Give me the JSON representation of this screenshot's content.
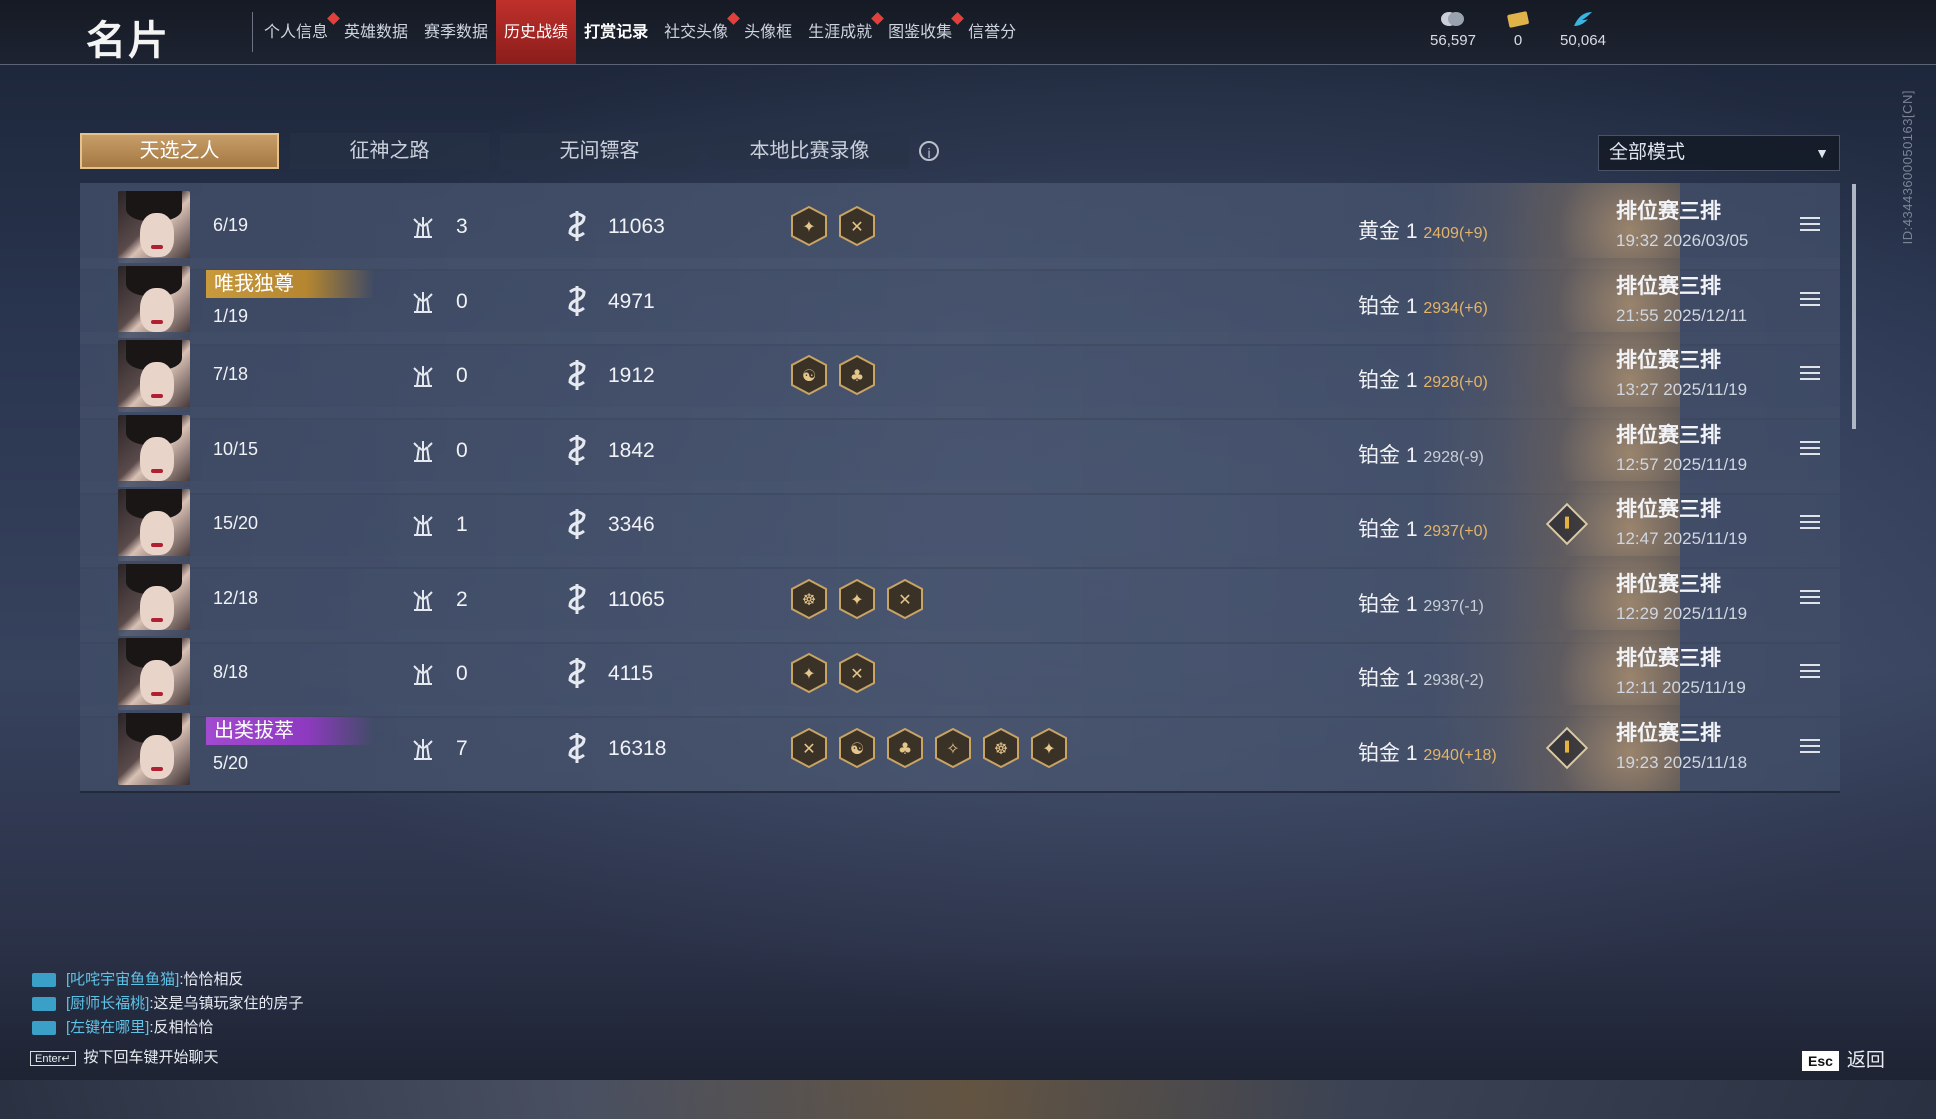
{
  "header": {
    "title": "名片",
    "tabs": [
      {
        "label": "个人信息",
        "dot": true
      },
      {
        "label": "英雄数据",
        "dot": false
      },
      {
        "label": "赛季数据",
        "dot": false
      },
      {
        "label": "历史战绩",
        "dot": false,
        "active": true
      },
      {
        "label": "打赏记录",
        "dot": false,
        "bold": true
      },
      {
        "label": "社交头像",
        "dot": true
      },
      {
        "label": "头像框",
        "dot": false
      },
      {
        "label": "生涯成就",
        "dot": true
      },
      {
        "label": "图鉴收集",
        "dot": true
      },
      {
        "label": "信誉分",
        "dot": false
      }
    ],
    "currencies": [
      {
        "icon": "coin-icon",
        "value": "56,597"
      },
      {
        "icon": "ticket-icon",
        "value": "0"
      },
      {
        "icon": "feather-icon",
        "value": "50,064"
      }
    ]
  },
  "sub_tabs": [
    "天选之人",
    "征神之路",
    "无间镖客",
    "本地比赛录像"
  ],
  "mode_select": {
    "value": "全部模式"
  },
  "side_id": "ID:43443600050163[CN]",
  "matches": [
    {
      "kda": "6/19",
      "badge": "",
      "mvp": "3",
      "score": "11063",
      "achievements": 2,
      "rank": "黄金 1",
      "pts": "2409(+9)",
      "trend": "gain",
      "diamond": false,
      "mode": "排位赛三排",
      "time": "19:32  2026/03/05"
    },
    {
      "kda": "1/19",
      "badge": "唯我独尊",
      "badge_color": "gold",
      "mvp": "0",
      "score": "4971",
      "achievements": 0,
      "rank": "铂金 1",
      "pts": "2934(+6)",
      "trend": "gain",
      "diamond": false,
      "mode": "排位赛三排",
      "time": "21:55  2025/12/11"
    },
    {
      "kda": "7/18",
      "badge": "",
      "mvp": "0",
      "score": "1912",
      "achievements": 2,
      "rank": "铂金 1",
      "pts": "2928(+0)",
      "trend": "gain",
      "diamond": false,
      "mode": "排位赛三排",
      "time": "13:27  2025/11/19"
    },
    {
      "kda": "10/15",
      "badge": "",
      "mvp": "0",
      "score": "1842",
      "achievements": 0,
      "rank": "铂金 1",
      "pts": "2928(-9)",
      "trend": "loss",
      "diamond": false,
      "mode": "排位赛三排",
      "time": "12:57  2025/11/19"
    },
    {
      "kda": "15/20",
      "badge": "",
      "mvp": "1",
      "score": "3346",
      "achievements": 0,
      "rank": "铂金 1",
      "pts": "2937(+0)",
      "trend": "gain",
      "diamond": true,
      "mode": "排位赛三排",
      "time": "12:47  2025/11/19"
    },
    {
      "kda": "12/18",
      "badge": "",
      "mvp": "2",
      "score": "11065",
      "achievements": 3,
      "rank": "铂金 1",
      "pts": "2937(-1)",
      "trend": "loss",
      "diamond": false,
      "mode": "排位赛三排",
      "time": "12:29  2025/11/19"
    },
    {
      "kda": "8/18",
      "badge": "",
      "mvp": "0",
      "score": "4115",
      "achievements": 2,
      "rank": "铂金 1",
      "pts": "2938(-2)",
      "trend": "loss",
      "diamond": false,
      "mode": "排位赛三排",
      "time": "12:11  2025/11/19"
    },
    {
      "kda": "5/20",
      "badge": "出类拔萃",
      "badge_color": "purple",
      "mvp": "7",
      "score": "16318",
      "achievements": 6,
      "rank": "铂金 1",
      "pts": "2940(+18)",
      "trend": "gain",
      "diamond": true,
      "mode": "排位赛三排",
      "time": "19:23  2025/11/18"
    }
  ],
  "chat": [
    {
      "name": "[叱咤宇宙鱼鱼猫]",
      "text": ":恰恰相反"
    },
    {
      "name": "[厨师长福桃]",
      "text": ":这是乌镇玩家住的房子"
    },
    {
      "name": "[左键在哪里]",
      "text": ":反相恰恰"
    }
  ],
  "chat_hint": {
    "key": "Enter↵",
    "text": "按下回车键开始聊天"
  },
  "back": {
    "key": "Esc",
    "label": "返回"
  },
  "colors": {
    "accent_red": "#c0302b",
    "tab_gold": "#b58a52",
    "gain": "#e3b46a",
    "chat_name": "#5ec3e6"
  }
}
